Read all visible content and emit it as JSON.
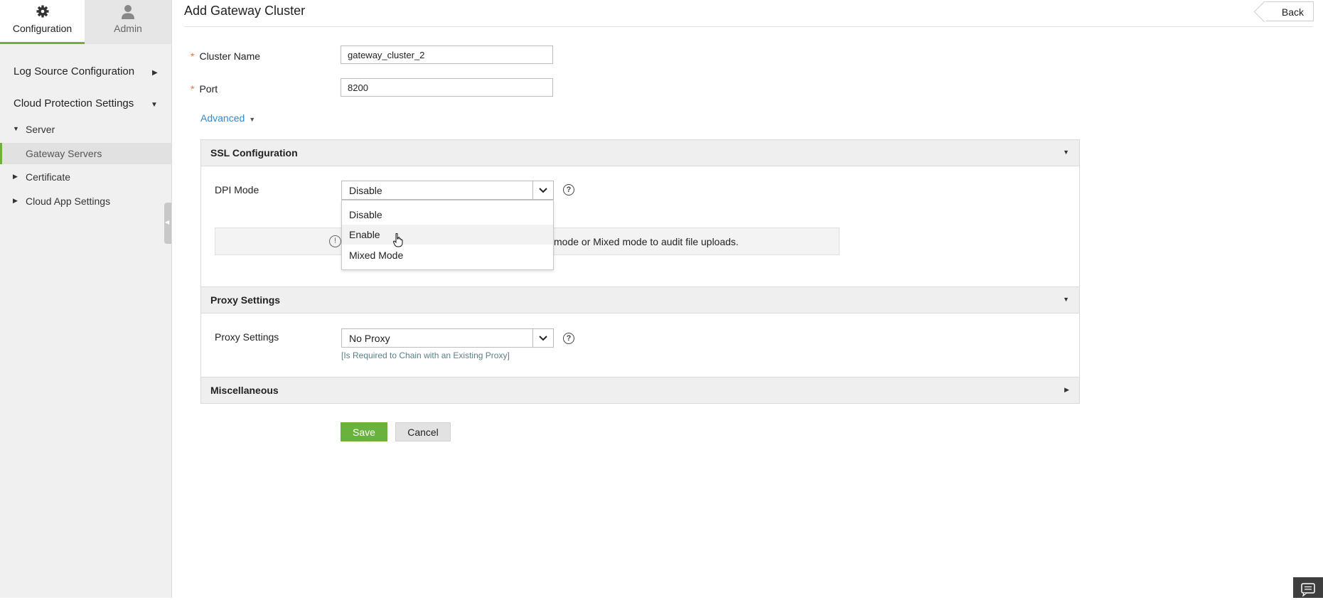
{
  "sidebar": {
    "tabs": [
      {
        "label": "Configuration",
        "icon": "gear-icon"
      },
      {
        "label": "Admin",
        "icon": "user-icon"
      }
    ],
    "log_source": "Log Source Configuration",
    "cloud_protection": "Cloud Protection Settings",
    "server": "Server",
    "gateway_servers": "Gateway Servers",
    "certificate": "Certificate",
    "cloud_app_settings": "Cloud App Settings"
  },
  "header": {
    "title": "Add Gateway Cluster",
    "back_label": "Back"
  },
  "form": {
    "required_mark": "*",
    "cluster_name_label": "Cluster Name",
    "cluster_name_value": "gateway_cluster_2",
    "port_label": "Port",
    "port_value": "8200",
    "advanced_label": "Advanced"
  },
  "ssl": {
    "title": "SSL Configuration",
    "dpi_label": "DPI Mode",
    "dpi_value": "Disable",
    "dpi_options": [
      "Disable",
      "Enable",
      "Mixed Mode"
    ],
    "info_text": "mode or Mixed mode to audit file uploads."
  },
  "proxy": {
    "title": "Proxy Settings",
    "label": "Proxy Settings",
    "value": "No Proxy",
    "hint": "[Is Required to Chain with an Existing Proxy]"
  },
  "misc": {
    "title": "Miscellaneous"
  },
  "actions": {
    "save_label": "Save",
    "cancel_label": "Cancel"
  },
  "colors": {
    "accent_green": "#6ab23e",
    "link_blue": "#2a8bd0",
    "required_orange": "#e8772e"
  }
}
